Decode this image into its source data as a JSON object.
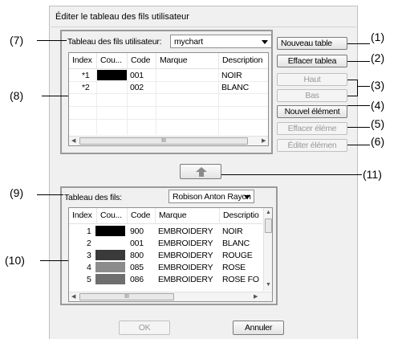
{
  "dialog": {
    "title": "Éditer le tableau des fils utilisateur"
  },
  "user_chart": {
    "label": "Tableau des fils utilisateur:",
    "selected": "mychart",
    "columns": [
      "Index",
      "Cou...",
      "Code",
      "Marque",
      "Description"
    ],
    "rows": [
      {
        "index": "*1",
        "color": "#000000",
        "code": "001",
        "brand": "",
        "description": "NOIR"
      },
      {
        "index": "*2",
        "color": "#ffffff",
        "code": "002",
        "brand": "",
        "description": "BLANC"
      }
    ],
    "hscroll_thumb": "III"
  },
  "buttons": {
    "new_chart": "Nouveau table",
    "delete_chart": "Effacer tablea",
    "up": "Haut",
    "down": "Bas",
    "new_item": "Nouvel élément",
    "delete_item": "Effacer éléme",
    "edit_item": "Éditer élémen",
    "ok": "OK",
    "cancel": "Annuler"
  },
  "thread_chart": {
    "label": "Tableau des fils:",
    "selected": "Robison Anton Rayon",
    "columns": [
      "Index",
      "Cou...",
      "Code",
      "Marque",
      "Descriptio"
    ],
    "rows": [
      {
        "index": "1",
        "color": "#000000",
        "code": "900",
        "brand": "EMBROIDERY",
        "description": "NOIR"
      },
      {
        "index": "2",
        "color": "#ffffff",
        "code": "001",
        "brand": "EMBROIDERY",
        "description": "BLANC"
      },
      {
        "index": "3",
        "color": "#3a3a3a",
        "code": "800",
        "brand": "EMBROIDERY",
        "description": "ROUGE"
      },
      {
        "index": "4",
        "color": "#8c8c8c",
        "code": "085",
        "brand": "EMBROIDERY",
        "description": "ROSE"
      },
      {
        "index": "5",
        "color": "#6e6e6e",
        "code": "086",
        "brand": "EMBROIDERY",
        "description": "ROSE FO"
      }
    ],
    "hscroll_thumb": "III"
  },
  "callouts": [
    "(1)",
    "(2)",
    "(3)",
    "(4)",
    "(5)",
    "(6)",
    "(7)",
    "(8)",
    "(9)",
    "(10)",
    "(11)"
  ]
}
